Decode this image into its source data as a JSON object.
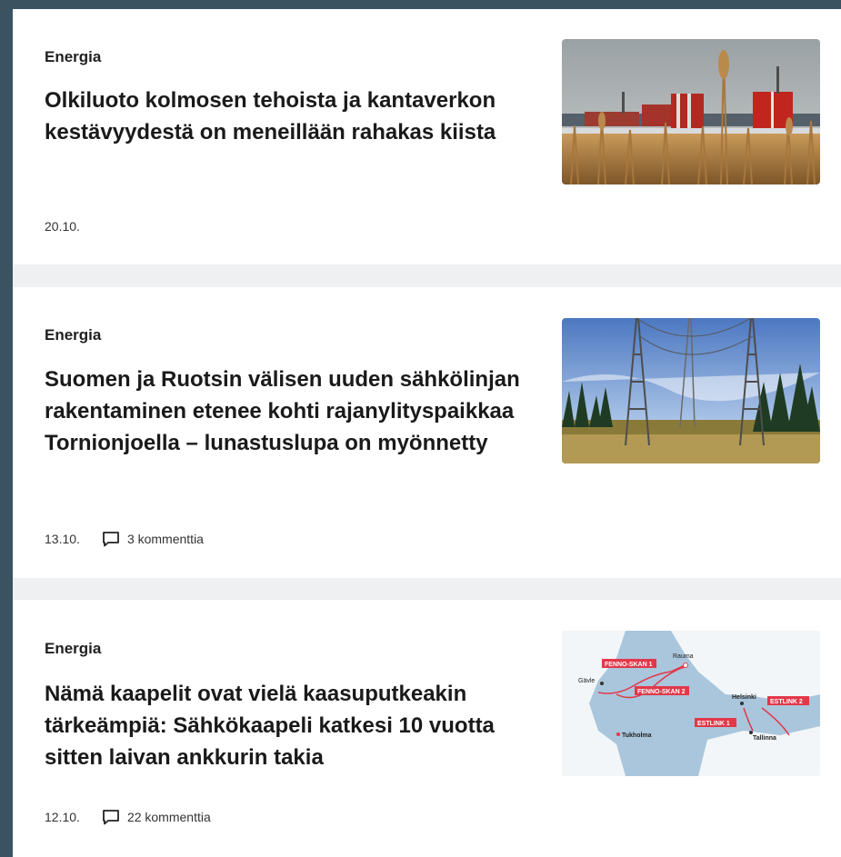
{
  "articles": [
    {
      "category": "Energia",
      "headline": "Olkiluoto kolmosen tehoista ja kantaverkon kestävyydestä on meneillään rahakas kiista",
      "date": "20.10."
    },
    {
      "category": "Energia",
      "headline": "Suomen ja Ruotsin välisen uuden sähkölinjan rakentaminen etenee kohti rajanylityspaikkaa Tornionjoella – lunastuslupa on myönnetty",
      "date": "13.10.",
      "comments": "3 kommenttia"
    },
    {
      "category": "Energia",
      "headline": "Nämä kaapelit ovat vielä kaasuputkeakin tärkeämpiä: Sähkökaapeli katkesi 10 vuotta sitten laivan ankkurin takia",
      "date": "12.10.",
      "comments": "22 kommenttia",
      "map_labels": {
        "fenno_skan_1": "FENNO-SKAN 1",
        "fenno_skan_2": "FENNO-SKAN 2",
        "estlink_1": "ESTLINK 1",
        "estlink_2": "ESTLINK 2",
        "rauma": "Rauma",
        "gavle": "Gävle",
        "helsinki": "Helsinki",
        "tukholma": "Tukholma",
        "tallinna": "Tallinna"
      }
    }
  ],
  "icons": {
    "comment": "comment-bubble-icon"
  },
  "colors": {
    "page_frame": "#3b5361",
    "separator": "#eef0f2",
    "card": "#ffffff",
    "map_label": "#e2384a"
  }
}
